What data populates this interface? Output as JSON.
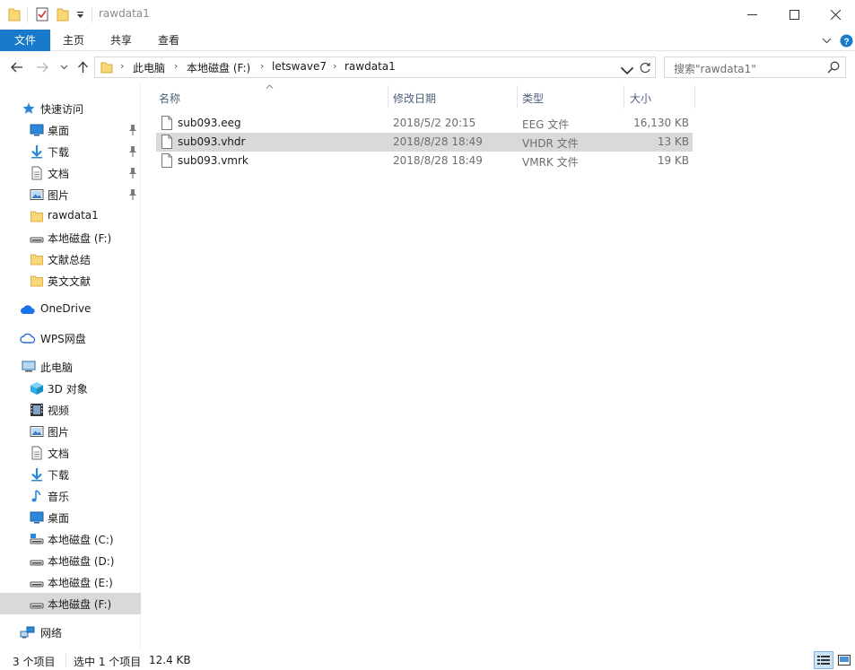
{
  "window": {
    "title": "rawdata1",
    "minimize_icon": "minimize-icon",
    "maximize_icon": "maximize-icon",
    "close_icon": "close-icon"
  },
  "ribbon": {
    "tabs": [
      {
        "label": "文件",
        "active": true
      },
      {
        "label": "主页"
      },
      {
        "label": "共享"
      },
      {
        "label": "查看"
      }
    ]
  },
  "address": {
    "crumbs": [
      "此电脑",
      "本地磁盘 (F:)",
      "letswave7",
      "rawdata1"
    ]
  },
  "search": {
    "placeholder": "搜索\"rawdata1\""
  },
  "sidebar": {
    "quick_access": "快速访问",
    "quick_items": [
      {
        "label": "桌面",
        "icon": "desktop-icon"
      },
      {
        "label": "下载",
        "icon": "download-icon"
      },
      {
        "label": "文档",
        "icon": "document-icon"
      },
      {
        "label": "图片",
        "icon": "picture-icon"
      },
      {
        "label": "rawdata1",
        "icon": "folder-icon"
      },
      {
        "label": "本地磁盘 (F:)",
        "icon": "drive-icon"
      },
      {
        "label": "文献总结",
        "icon": "folder-icon"
      },
      {
        "label": "英文文献",
        "icon": "folder-icon"
      }
    ],
    "onedrive": "OneDrive",
    "wps": "WPS网盘",
    "this_pc": "此电脑",
    "pc_items": [
      {
        "label": "3D 对象",
        "icon": "3d-objects-icon"
      },
      {
        "label": "视频",
        "icon": "video-icon"
      },
      {
        "label": "图片",
        "icon": "picture-icon"
      },
      {
        "label": "文档",
        "icon": "document-icon"
      },
      {
        "label": "下载",
        "icon": "download-icon"
      },
      {
        "label": "音乐",
        "icon": "music-icon"
      },
      {
        "label": "桌面",
        "icon": "desktop-icon"
      },
      {
        "label": "本地磁盘 (C:)",
        "icon": "drive-icon"
      },
      {
        "label": "本地磁盘 (D:)",
        "icon": "drive-icon"
      },
      {
        "label": "本地磁盘 (E:)",
        "icon": "drive-icon"
      },
      {
        "label": "本地磁盘 (F:)",
        "icon": "drive-icon",
        "selected": true
      }
    ],
    "network": "网络"
  },
  "columns": {
    "name": "名称",
    "date": "修改日期",
    "type": "类型",
    "size": "大小"
  },
  "files": [
    {
      "name": "sub093.eeg",
      "date": "2018/5/2 20:15",
      "type": "EEG 文件",
      "size": "16,130 KB"
    },
    {
      "name": "sub093.vhdr",
      "date": "2018/8/28 18:49",
      "type": "VHDR 文件",
      "size": "13 KB",
      "selected": true
    },
    {
      "name": "sub093.vmrk",
      "date": "2018/8/28 18:49",
      "type": "VMRK 文件",
      "size": "19 KB"
    }
  ],
  "status": {
    "count": "3 个项目",
    "selection": "选中 1 个项目",
    "selection_size": "12.4 KB"
  },
  "colors": {
    "accent": "#1979ca",
    "folder": "#f8d775",
    "selection": "#d9d9d9"
  }
}
